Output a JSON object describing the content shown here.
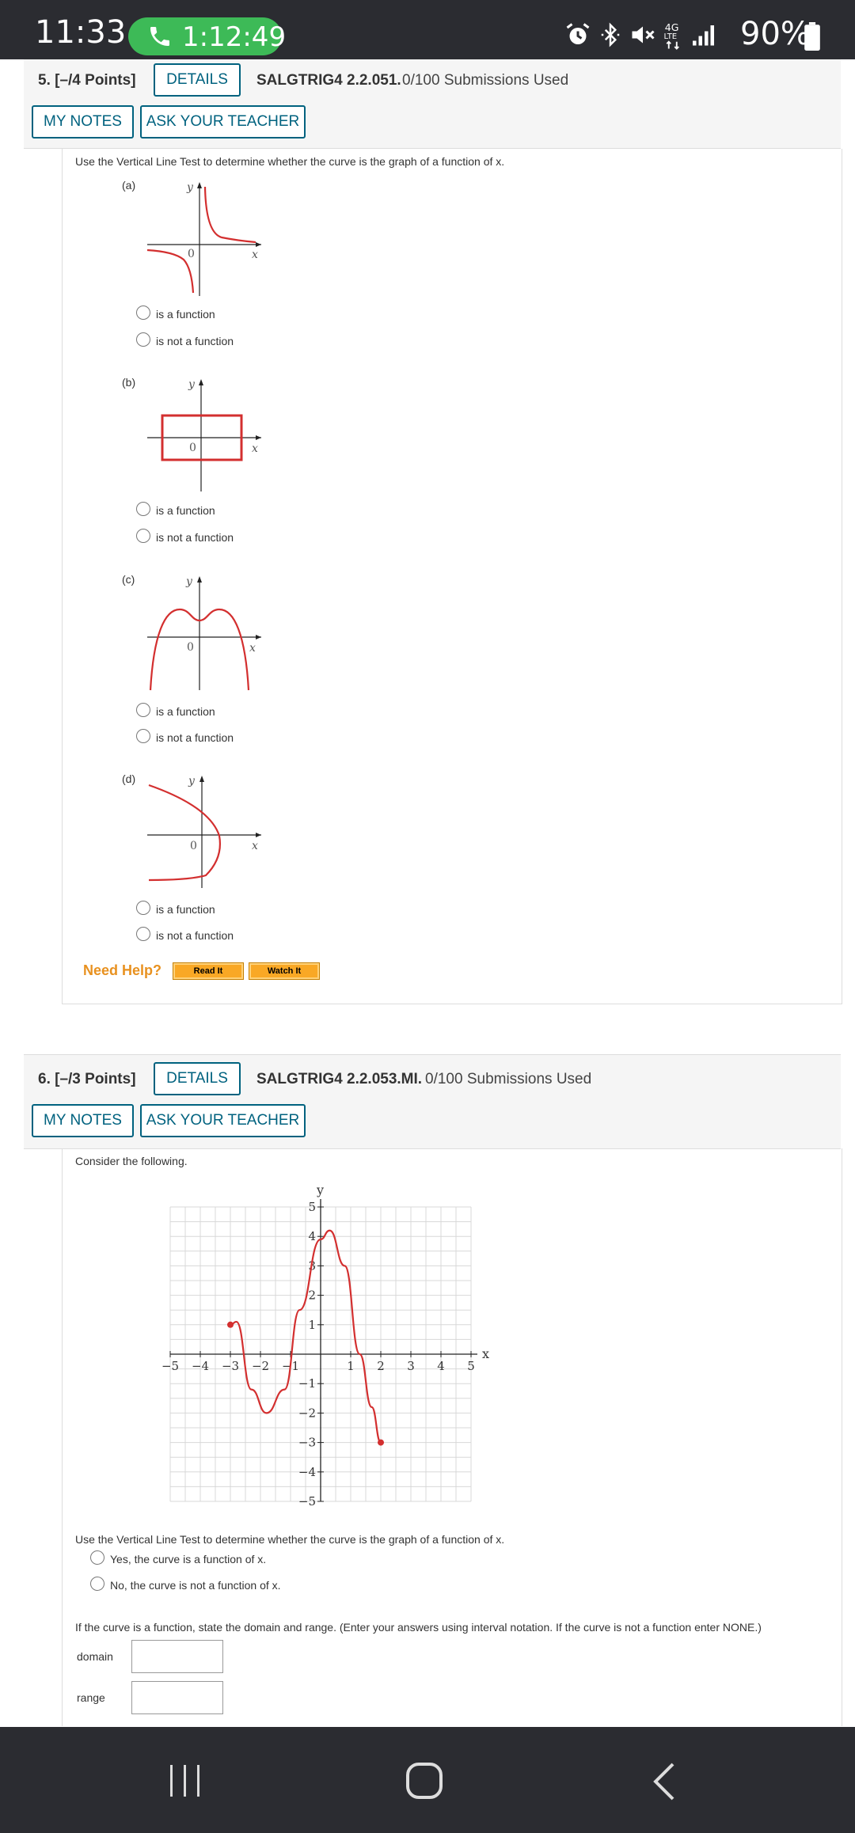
{
  "status_bar": {
    "time": "11:33",
    "call_timer": "1:12:49",
    "battery": "90%",
    "icons": [
      "alarm-icon",
      "bluetooth-icon",
      "mute-icon",
      "4g-lte-icon",
      "signal-icon",
      "battery-icon"
    ]
  },
  "q5": {
    "title": "5.  [–/4 Points]",
    "details_label": "DETAILS",
    "code": "SALGTRIG4 2.2.051.",
    "submissions": "0/100 Submissions Used",
    "notes_label": "MY NOTES",
    "ask_label": "ASK YOUR TEACHER",
    "instruction": "Use the Vertical Line Test to determine whether the curve is the graph of a function of x.",
    "parts": [
      {
        "label": "(a)",
        "options": [
          "is a function",
          "is not a function"
        ]
      },
      {
        "label": "(b)",
        "options": [
          "is a function",
          "is not a function"
        ]
      },
      {
        "label": "(c)",
        "options": [
          "is a function",
          "is not a function"
        ]
      },
      {
        "label": "(d)",
        "options": [
          "is a function",
          "is not a function"
        ]
      }
    ],
    "graph_axis": {
      "x": "x",
      "y": "y",
      "origin": "0"
    },
    "need_help": "Need Help?",
    "read_it": "Read It",
    "watch_it": "Watch It"
  },
  "q6": {
    "title": "6.  [–/3 Points]",
    "details_label": "DETAILS",
    "code": "SALGTRIG4 2.2.053.MI.",
    "submissions": "0/100 Submissions Used",
    "notes_label": "MY NOTES",
    "ask_label": "ASK YOUR TEACHER",
    "intro": "Consider the following.",
    "instruction": "Use the Vertical Line Test to determine whether the curve is the graph of a function of x.",
    "options": [
      "Yes, the curve is a function of x.",
      "No, the curve is not a function of x."
    ],
    "domain_prompt": "If the curve is a function, state the domain and range. (Enter your answers using interval notation. If the curve is not a function enter NONE.)",
    "domain_label": "domain",
    "range_label": "range"
  },
  "chart_data": {
    "type": "line",
    "xlabel": "x",
    "ylabel": "y",
    "xlim": [
      -5,
      5
    ],
    "ylim": [
      -5,
      5
    ],
    "x_ticks": [
      "−5",
      "−4",
      "−3",
      "−2",
      "−1",
      "1",
      "2",
      "3",
      "4",
      "5"
    ],
    "y_ticks": [
      "5",
      "4",
      "3",
      "2",
      "1",
      "−1",
      "−2",
      "−3",
      "−4",
      "−5"
    ],
    "grid": true,
    "series": [
      {
        "x": [
          -3,
          -2.8,
          -2.3,
          -1.8,
          -1.2,
          -0.7,
          0,
          0.3,
          0.8,
          1.3,
          1.7,
          2
        ],
        "y": [
          1,
          1.1,
          -1.2,
          -2,
          -1.2,
          1.5,
          3.9,
          4.2,
          3,
          0,
          -1.8,
          -3
        ]
      }
    ],
    "endpoints": [
      {
        "x": -3,
        "y": 1
      },
      {
        "x": 2,
        "y": -3
      }
    ],
    "color": "#d32f2f"
  },
  "navbar": {
    "icons": [
      "recent-apps-icon",
      "home-icon",
      "back-icon"
    ]
  }
}
